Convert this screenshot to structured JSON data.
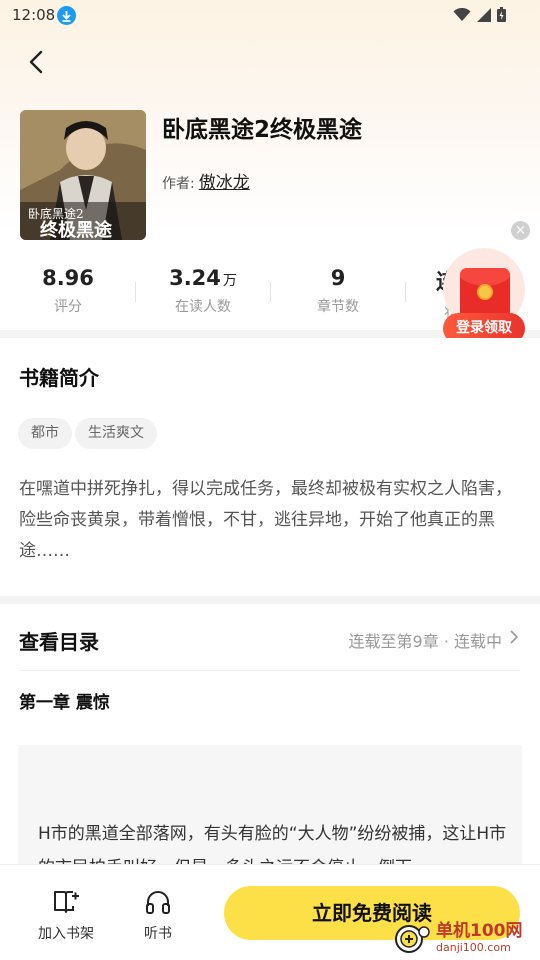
{
  "status_bar": {
    "time": "12:08"
  },
  "book": {
    "title": "卧底黑途2终极黑途",
    "author_label": "作者:",
    "author": "傲冰龙",
    "cover_text": "卧底黑途2 终极黑途"
  },
  "stats": [
    {
      "value": "8.96",
      "unit": "",
      "label": "评分"
    },
    {
      "value": "3.24",
      "unit": "万",
      "label": "在读人数"
    },
    {
      "value": "9",
      "unit": "",
      "label": "章节数"
    },
    {
      "value": "连",
      "unit": "",
      "label": "状"
    }
  ],
  "promo": {
    "button_label": "登录领取",
    "close": "×"
  },
  "intro": {
    "title": "书籍简介",
    "tags": [
      "都市",
      "生活爽文"
    ],
    "text": "在嘿道中拼死挣扎，得以完成任务，最终却被极有实权之人陷害，险些命丧黄泉，带着憎恨，不甘，逃往异地，开始了他真正的黑途……"
  },
  "toc": {
    "title": "查看目录",
    "status": "连载至第9章 · 连载中",
    "chapter_title": "第一章 震惊",
    "preview": "H市的黑道全部落网，有头有脸的“大人物”纷纷被捕，这让H市的市民拍手叫好，但是，多头之运不会停止，倒下"
  },
  "bottom": {
    "bookshelf_label": "加入书架",
    "listen_label": "听书",
    "read_label": "立即免费阅读"
  },
  "watermark": {
    "main": "单机100网",
    "sub": "danji100.com"
  },
  "colors": {
    "accent": "#fde047",
    "promo_red": "#ea2c28",
    "download_blue": "#1e9bf0"
  }
}
